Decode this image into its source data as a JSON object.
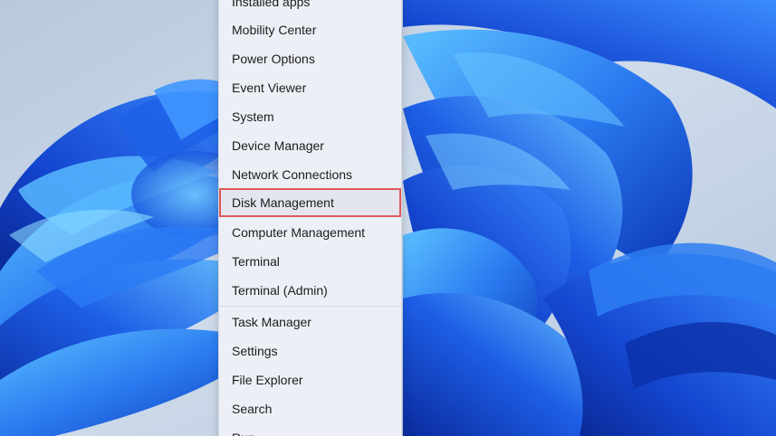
{
  "context_menu": {
    "items_group1": [
      "Installed apps",
      "Mobility Center",
      "Power Options",
      "Event Viewer",
      "System",
      "Device Manager",
      "Network Connections",
      "Disk Management",
      "Computer Management",
      "Terminal",
      "Terminal (Admin)"
    ],
    "items_group2": [
      "Task Manager",
      "Settings",
      "File Explorer",
      "Search",
      "Run"
    ],
    "selected_item": "Disk Management",
    "highlight_color": "#e0585c"
  },
  "colors": {
    "wallpaper_bg": "#c9d6e6",
    "bloom_primary": "#1f5fe0",
    "bloom_light": "#3fa0ff",
    "bloom_dark": "#0b2fa8",
    "menu_bg": "#eceff6"
  }
}
